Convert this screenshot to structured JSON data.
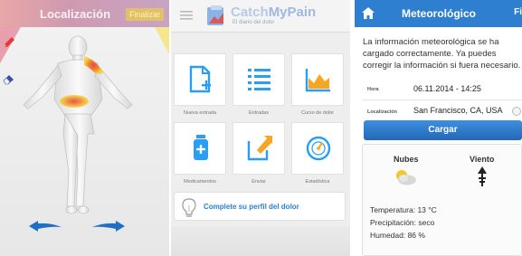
{
  "screen1": {
    "header": {
      "title": "Localización",
      "finish_label": "Finalizar"
    },
    "colors": {
      "pain_red": "#e8443a",
      "pain_yellow": "#f5d22b",
      "arrow_blue": "#1f6fc6"
    }
  },
  "screen2": {
    "brand": {
      "name_prefix": "Catch",
      "name_suffix": "MyPain",
      "tagline": "El diario del dolor"
    },
    "tiles": [
      {
        "label": "Nueva entrada",
        "icon": "new-entry-icon"
      },
      {
        "label": "Entradas",
        "icon": "list-icon"
      },
      {
        "label": "Curso de dolor",
        "icon": "area-chart-icon"
      },
      {
        "label": "Medicamentos",
        "icon": "medication-icon"
      },
      {
        "label": "Enviar",
        "icon": "send-icon"
      },
      {
        "label": "Estadística",
        "icon": "gauge-icon"
      }
    ],
    "banner": {
      "text": "Complete su perfil del dolor",
      "icon": "lightbulb-icon"
    },
    "colors": {
      "accent": "#2a9df4"
    }
  },
  "screen3": {
    "header": {
      "title": "Meteorológico",
      "finish_label": "Fi"
    },
    "message": "La información meteorológica se ha cargado correctamente. Ya puedes corregir la información si fuera necesario.",
    "fields": {
      "time_label": "Hora",
      "time_value": "06.11.2014 - 14:25",
      "location_label": "Localización",
      "location_value": "San Francisco, CA, USA"
    },
    "button_label": "Cargar",
    "card": {
      "clouds_label": "Nubes",
      "wind_label": "Viento",
      "temperature": "Temperatura:  13 °C",
      "precipitation": "Precipitación:  seco",
      "humidity": "Humedad:  86 %"
    },
    "colors": {
      "header_blue": "#2f7fd0"
    }
  }
}
